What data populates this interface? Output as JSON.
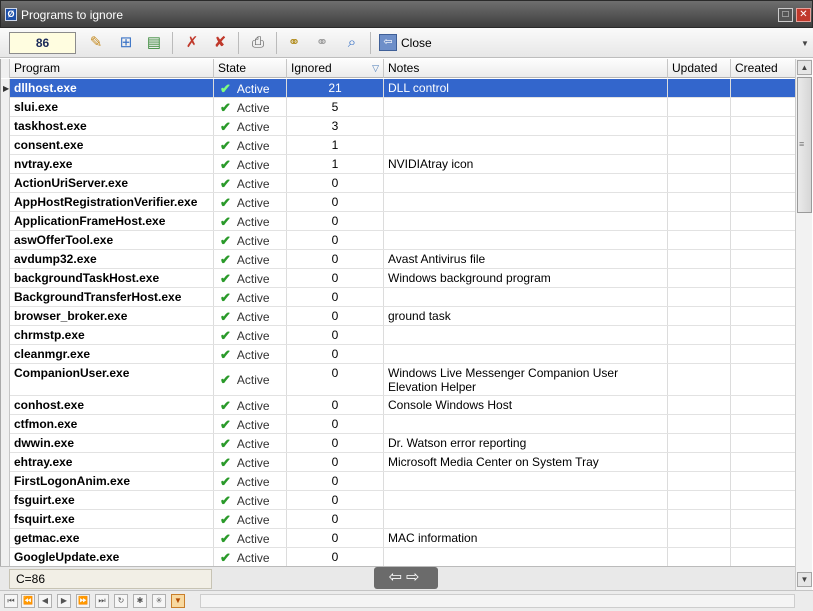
{
  "window": {
    "title": "Programs to ignore",
    "maximize_label": "□",
    "close_label": "✕"
  },
  "toolbar": {
    "count": "86",
    "close_label": "Close"
  },
  "columns": {
    "program": "Program",
    "state": "State",
    "ignored": "Ignored",
    "notes": "Notes",
    "updated": "Updated",
    "created": "Created"
  },
  "rows": [
    {
      "name": "dllhost.exe",
      "state": "Active",
      "ignored": "21",
      "notes": "DLL control"
    },
    {
      "name": "slui.exe",
      "state": "Active",
      "ignored": "5",
      "notes": ""
    },
    {
      "name": "taskhost.exe",
      "state": "Active",
      "ignored": "3",
      "notes": ""
    },
    {
      "name": "consent.exe",
      "state": "Active",
      "ignored": "1",
      "notes": ""
    },
    {
      "name": "nvtray.exe",
      "state": "Active",
      "ignored": "1",
      "notes": "NVIDIAtray icon"
    },
    {
      "name": "ActionUriServer.exe",
      "state": "Active",
      "ignored": "0",
      "notes": ""
    },
    {
      "name": "AppHostRegistrationVerifier.exe",
      "state": "Active",
      "ignored": "0",
      "notes": ""
    },
    {
      "name": "ApplicationFrameHost.exe",
      "state": "Active",
      "ignored": "0",
      "notes": ""
    },
    {
      "name": "aswOfferTool.exe",
      "state": "Active",
      "ignored": "0",
      "notes": ""
    },
    {
      "name": "avdump32.exe",
      "state": "Active",
      "ignored": "0",
      "notes": "Avast Antivirus file"
    },
    {
      "name": "backgroundTaskHost.exe",
      "state": "Active",
      "ignored": "0",
      "notes": "Windows background program"
    },
    {
      "name": "BackgroundTransferHost.exe",
      "state": "Active",
      "ignored": "0",
      "notes": ""
    },
    {
      "name": "browser_broker.exe",
      "state": "Active",
      "ignored": "0",
      "notes": "ground task"
    },
    {
      "name": "chrmstp.exe",
      "state": "Active",
      "ignored": "0",
      "notes": ""
    },
    {
      "name": "cleanmgr.exe",
      "state": "Active",
      "ignored": "0",
      "notes": ""
    },
    {
      "name": "CompanionUser.exe",
      "state": "Active",
      "ignored": "0",
      "notes": "Windows Live Messenger Companion User Elevation Helper"
    },
    {
      "name": "conhost.exe",
      "state": "Active",
      "ignored": "0",
      "notes": "Console Windows Host"
    },
    {
      "name": "ctfmon.exe",
      "state": "Active",
      "ignored": "0",
      "notes": ""
    },
    {
      "name": "dwwin.exe",
      "state": "Active",
      "ignored": "0",
      "notes": "Dr. Watson error reporting"
    },
    {
      "name": "ehtray.exe",
      "state": "Active",
      "ignored": "0",
      "notes": "Microsoft Media Center on System Tray"
    },
    {
      "name": "FirstLogonAnim.exe",
      "state": "Active",
      "ignored": "0",
      "notes": ""
    },
    {
      "name": "fsguirt.exe",
      "state": "Active",
      "ignored": "0",
      "notes": ""
    },
    {
      "name": "fsquirt.exe",
      "state": "Active",
      "ignored": "0",
      "notes": ""
    },
    {
      "name": "getmac.exe",
      "state": "Active",
      "ignored": "0",
      "notes": "MAC information"
    },
    {
      "name": "GoogleUpdate.exe",
      "state": "Active",
      "ignored": "0",
      "notes": ""
    }
  ],
  "footer": {
    "count_text": "C=86"
  },
  "icons": {
    "toolbar": [
      "edit-icon",
      "add-icon",
      "folder-icon",
      "delete-icon",
      "delete-all-icon",
      "print-icon",
      "link-icon",
      "link-disabled-icon",
      "search-icon",
      "close-icon"
    ]
  }
}
